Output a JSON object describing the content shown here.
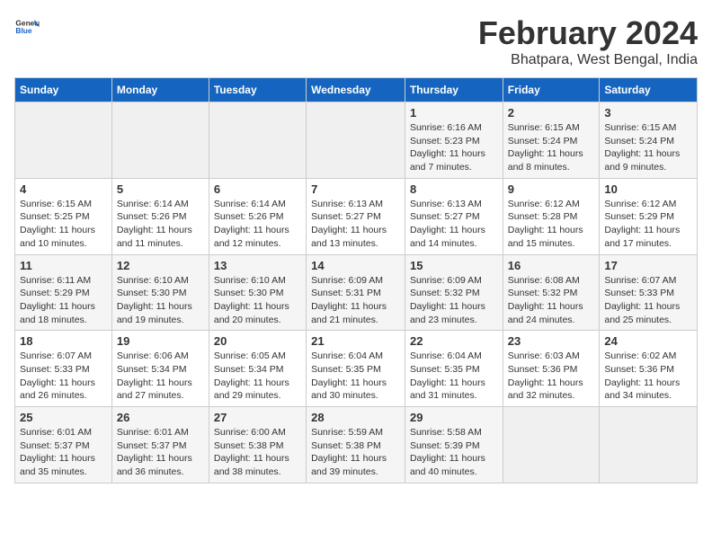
{
  "header": {
    "logo_general": "General",
    "logo_blue": "Blue",
    "title": "February 2024",
    "subtitle": "Bhatpara, West Bengal, India"
  },
  "days_of_week": [
    "Sunday",
    "Monday",
    "Tuesday",
    "Wednesday",
    "Thursday",
    "Friday",
    "Saturday"
  ],
  "weeks": [
    [
      {
        "day": "",
        "sunrise": "",
        "sunset": "",
        "daylight": "",
        "empty": true
      },
      {
        "day": "",
        "sunrise": "",
        "sunset": "",
        "daylight": "",
        "empty": true
      },
      {
        "day": "",
        "sunrise": "",
        "sunset": "",
        "daylight": "",
        "empty": true
      },
      {
        "day": "",
        "sunrise": "",
        "sunset": "",
        "daylight": "",
        "empty": true
      },
      {
        "day": "1",
        "sunrise": "6:16 AM",
        "sunset": "5:23 PM",
        "daylight": "11 hours and 7 minutes."
      },
      {
        "day": "2",
        "sunrise": "6:15 AM",
        "sunset": "5:24 PM",
        "daylight": "11 hours and 8 minutes."
      },
      {
        "day": "3",
        "sunrise": "6:15 AM",
        "sunset": "5:24 PM",
        "daylight": "11 hours and 9 minutes."
      }
    ],
    [
      {
        "day": "4",
        "sunrise": "6:15 AM",
        "sunset": "5:25 PM",
        "daylight": "11 hours and 10 minutes."
      },
      {
        "day": "5",
        "sunrise": "6:14 AM",
        "sunset": "5:26 PM",
        "daylight": "11 hours and 11 minutes."
      },
      {
        "day": "6",
        "sunrise": "6:14 AM",
        "sunset": "5:26 PM",
        "daylight": "11 hours and 12 minutes."
      },
      {
        "day": "7",
        "sunrise": "6:13 AM",
        "sunset": "5:27 PM",
        "daylight": "11 hours and 13 minutes."
      },
      {
        "day": "8",
        "sunrise": "6:13 AM",
        "sunset": "5:27 PM",
        "daylight": "11 hours and 14 minutes."
      },
      {
        "day": "9",
        "sunrise": "6:12 AM",
        "sunset": "5:28 PM",
        "daylight": "11 hours and 15 minutes."
      },
      {
        "day": "10",
        "sunrise": "6:12 AM",
        "sunset": "5:29 PM",
        "daylight": "11 hours and 17 minutes."
      }
    ],
    [
      {
        "day": "11",
        "sunrise": "6:11 AM",
        "sunset": "5:29 PM",
        "daylight": "11 hours and 18 minutes."
      },
      {
        "day": "12",
        "sunrise": "6:10 AM",
        "sunset": "5:30 PM",
        "daylight": "11 hours and 19 minutes."
      },
      {
        "day": "13",
        "sunrise": "6:10 AM",
        "sunset": "5:30 PM",
        "daylight": "11 hours and 20 minutes."
      },
      {
        "day": "14",
        "sunrise": "6:09 AM",
        "sunset": "5:31 PM",
        "daylight": "11 hours and 21 minutes."
      },
      {
        "day": "15",
        "sunrise": "6:09 AM",
        "sunset": "5:32 PM",
        "daylight": "11 hours and 23 minutes."
      },
      {
        "day": "16",
        "sunrise": "6:08 AM",
        "sunset": "5:32 PM",
        "daylight": "11 hours and 24 minutes."
      },
      {
        "day": "17",
        "sunrise": "6:07 AM",
        "sunset": "5:33 PM",
        "daylight": "11 hours and 25 minutes."
      }
    ],
    [
      {
        "day": "18",
        "sunrise": "6:07 AM",
        "sunset": "5:33 PM",
        "daylight": "11 hours and 26 minutes."
      },
      {
        "day": "19",
        "sunrise": "6:06 AM",
        "sunset": "5:34 PM",
        "daylight": "11 hours and 27 minutes."
      },
      {
        "day": "20",
        "sunrise": "6:05 AM",
        "sunset": "5:34 PM",
        "daylight": "11 hours and 29 minutes."
      },
      {
        "day": "21",
        "sunrise": "6:04 AM",
        "sunset": "5:35 PM",
        "daylight": "11 hours and 30 minutes."
      },
      {
        "day": "22",
        "sunrise": "6:04 AM",
        "sunset": "5:35 PM",
        "daylight": "11 hours and 31 minutes."
      },
      {
        "day": "23",
        "sunrise": "6:03 AM",
        "sunset": "5:36 PM",
        "daylight": "11 hours and 32 minutes."
      },
      {
        "day": "24",
        "sunrise": "6:02 AM",
        "sunset": "5:36 PM",
        "daylight": "11 hours and 34 minutes."
      }
    ],
    [
      {
        "day": "25",
        "sunrise": "6:01 AM",
        "sunset": "5:37 PM",
        "daylight": "11 hours and 35 minutes."
      },
      {
        "day": "26",
        "sunrise": "6:01 AM",
        "sunset": "5:37 PM",
        "daylight": "11 hours and 36 minutes."
      },
      {
        "day": "27",
        "sunrise": "6:00 AM",
        "sunset": "5:38 PM",
        "daylight": "11 hours and 38 minutes."
      },
      {
        "day": "28",
        "sunrise": "5:59 AM",
        "sunset": "5:38 PM",
        "daylight": "11 hours and 39 minutes."
      },
      {
        "day": "29",
        "sunrise": "5:58 AM",
        "sunset": "5:39 PM",
        "daylight": "11 hours and 40 minutes."
      },
      {
        "day": "",
        "sunrise": "",
        "sunset": "",
        "daylight": "",
        "empty": true
      },
      {
        "day": "",
        "sunrise": "",
        "sunset": "",
        "daylight": "",
        "empty": true
      }
    ]
  ]
}
